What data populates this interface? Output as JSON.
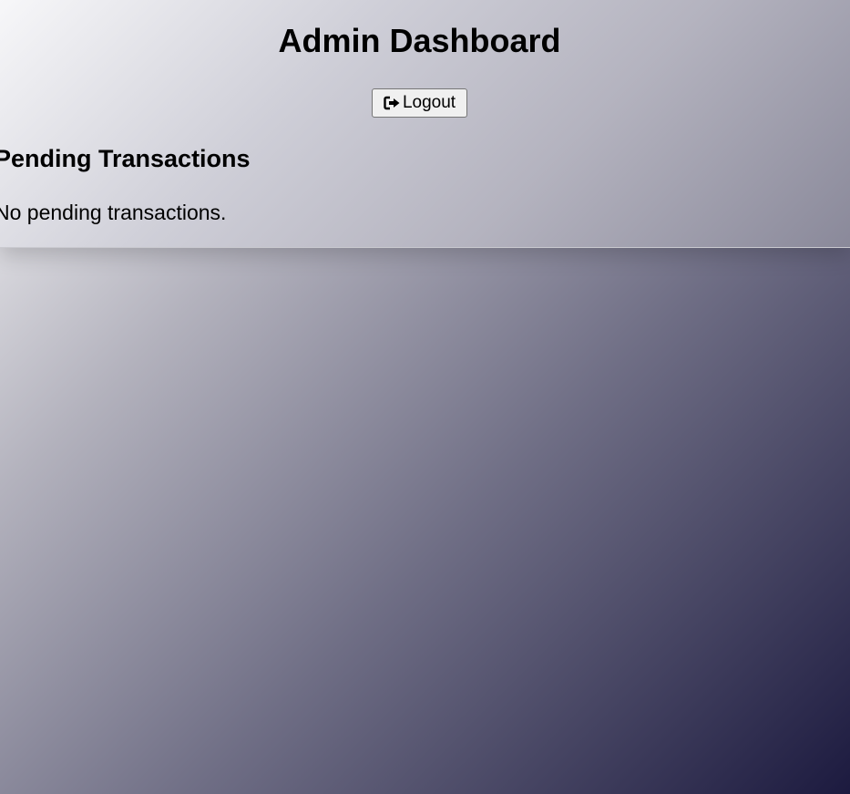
{
  "header": {
    "title": "Admin Dashboard",
    "logout_label": "Logout",
    "logout_icon": "logout-icon"
  },
  "pending": {
    "heading": "Pending Transactions",
    "empty_message": "No pending transactions."
  }
}
